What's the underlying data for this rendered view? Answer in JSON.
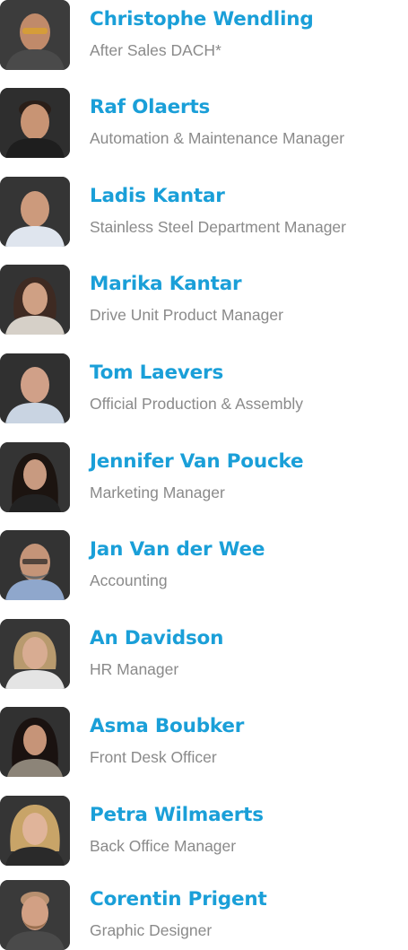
{
  "team": {
    "members": [
      {
        "name": "Christophe Wendling",
        "role": "After Sales DACH*",
        "photo": "person-photo"
      },
      {
        "name": "Raf Olaerts",
        "role": "Automation & Maintenance Manager",
        "photo": "person-photo"
      },
      {
        "name": "Ladis Kantar",
        "role": "Stainless Steel Department Manager",
        "photo": "person-photo"
      },
      {
        "name": "Marika Kantar",
        "role": "Drive Unit Product Manager",
        "photo": "person-photo"
      },
      {
        "name": "Tom Laevers",
        "role": "Official Production & Assembly",
        "photo": "person-photo"
      },
      {
        "name": "Jennifer Van Poucke",
        "role": "Marketing Manager",
        "photo": "person-photo"
      },
      {
        "name": "Jan Van der Wee",
        "role": "Accounting",
        "photo": "person-photo"
      },
      {
        "name": "An Davidson",
        "role": "HR Manager",
        "photo": "person-photo"
      },
      {
        "name": "Asma Boubker",
        "role": "Front Desk Officer",
        "photo": "person-photo"
      },
      {
        "name": "Petra Wilmaerts",
        "role": "Back Office Manager",
        "photo": "person-photo"
      },
      {
        "name": "Corentin Prigent",
        "role": "Graphic Designer",
        "photo": "person-photo"
      }
    ]
  },
  "colors": {
    "name": "#1a9fd8",
    "role": "#8a8a8a",
    "photo_background": "#3a3a3a"
  }
}
